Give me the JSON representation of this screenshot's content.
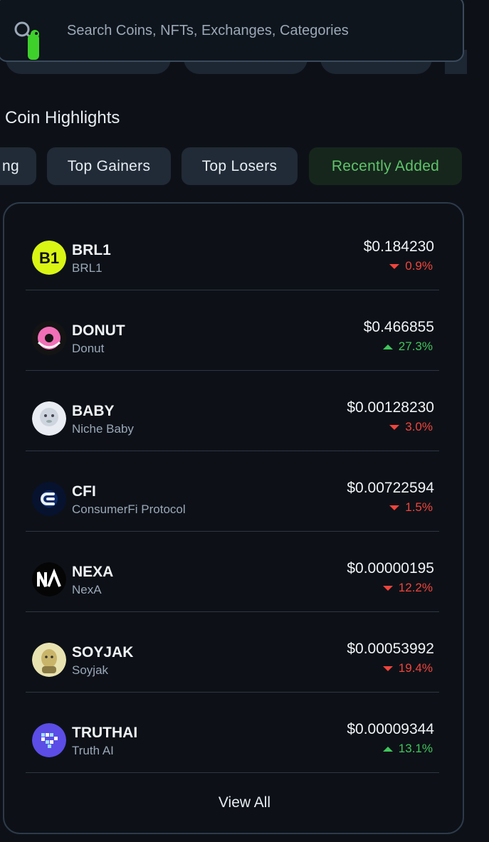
{
  "search": {
    "placeholder": "Search Coins, NFTs, Exchanges, Categories"
  },
  "section": {
    "title": "Coin Highlights"
  },
  "tabs": [
    {
      "label": "ng"
    },
    {
      "label": "Top Gainers"
    },
    {
      "label": "Top Losers"
    },
    {
      "label": "Recently Added",
      "active": true
    }
  ],
  "coins": [
    {
      "symbol": "BRL1",
      "name": "BRL1",
      "price": "$0.184230",
      "change": "0.9%",
      "direction": "down"
    },
    {
      "symbol": "DONUT",
      "name": "Donut",
      "price": "$0.466855",
      "change": "27.3%",
      "direction": "up"
    },
    {
      "symbol": "BABY",
      "name": "Niche Baby",
      "price": "$0.00128230",
      "change": "3.0%",
      "direction": "down"
    },
    {
      "symbol": "CFI",
      "name": "ConsumerFi Protocol",
      "price": "$0.00722594",
      "change": "1.5%",
      "direction": "down"
    },
    {
      "symbol": "NEXA",
      "name": "NexA",
      "price": "$0.00000195",
      "change": "12.2%",
      "direction": "down"
    },
    {
      "symbol": "SOYJAK",
      "name": "Soyjak",
      "price": "$0.00053992",
      "change": "19.4%",
      "direction": "down"
    },
    {
      "symbol": "TRUTHAI",
      "name": "Truth AI",
      "price": "$0.00009344",
      "change": "13.1%",
      "direction": "up"
    }
  ],
  "view_all_label": "View All",
  "colors": {
    "down": "#f0443c",
    "up": "#3fc55b",
    "accent_tab": "#5ec46a"
  }
}
